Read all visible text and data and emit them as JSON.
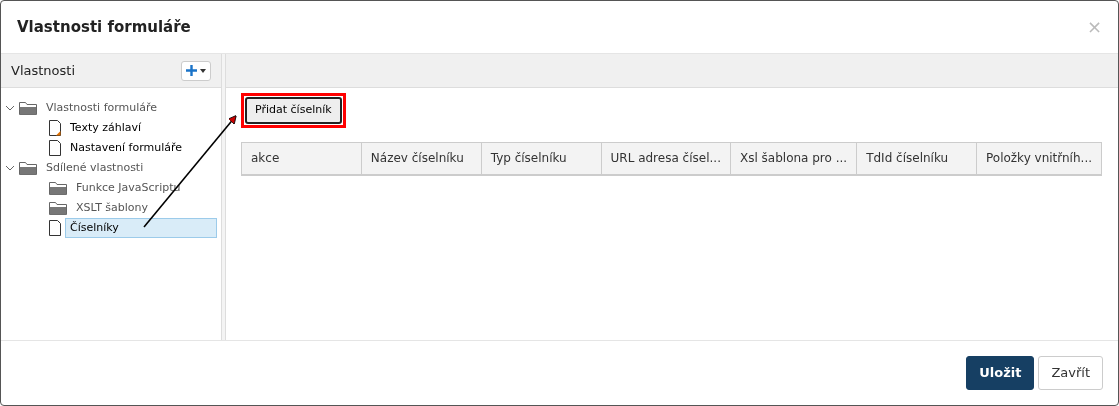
{
  "window": {
    "title": "Vlastnosti formuláře",
    "close": "×"
  },
  "sidebar": {
    "title": "Vlastnosti",
    "tree": [
      {
        "label": "Vlastnosti formuláře",
        "kind": "folder",
        "expanded": true,
        "selected": false,
        "children": [
          {
            "label": "Texty záhlaví",
            "kind": "document",
            "marked": true,
            "selected": false
          },
          {
            "label": "Nastavení formuláře",
            "kind": "document",
            "marked": false,
            "selected": false
          }
        ]
      },
      {
        "label": "Sdílené vlastnosti",
        "kind": "folder",
        "expanded": true,
        "selected": false,
        "children": [
          {
            "label": "Funkce JavaScriptu",
            "kind": "folder",
            "selected": false
          },
          {
            "label": "XSLT šablony",
            "kind": "folder",
            "selected": false
          },
          {
            "label": "Číselníky",
            "kind": "document",
            "marked": false,
            "selected": true
          }
        ]
      }
    ]
  },
  "add_button": {
    "label": "Přidat číselník",
    "highlighted": true
  },
  "table": {
    "columns": [
      "akce",
      "Název číselníku",
      "Typ číselníku",
      "URL adresa čísel...",
      "Xsl šablona pro ...",
      "TdId číselníku",
      "Položky vnitřníh..."
    ]
  },
  "buttons": [
    {
      "label": "Uložit",
      "kind": "primary"
    },
    {
      "label": "Zavřít",
      "kind": "secondary"
    }
  ]
}
